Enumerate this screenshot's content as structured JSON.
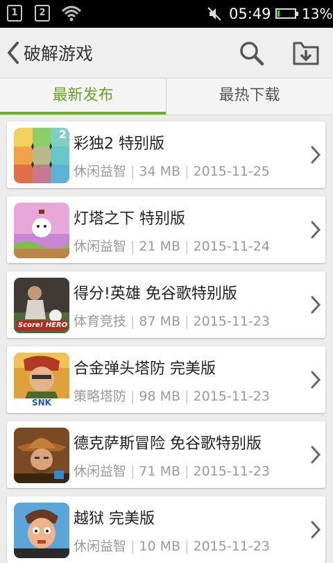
{
  "status_bar": {
    "sim1": "1",
    "sim2": "2",
    "time": "05:49",
    "battery_percent": "13%",
    "battery_level": 0.13
  },
  "header": {
    "title": "破解游戏"
  },
  "tabs": [
    {
      "label": "最新发布",
      "active": true
    },
    {
      "label": "最热下载",
      "active": false
    }
  ],
  "apps": [
    {
      "name": "彩独2 特别版",
      "category": "休闲益智",
      "size": "34 MB",
      "date": "2015-11-25",
      "icon": "color-sudoku-icon"
    },
    {
      "name": "灯塔之下 特别版",
      "category": "休闲益智",
      "size": "21 MB",
      "date": "2015-11-24",
      "icon": "lighthouse-icon"
    },
    {
      "name": "得分!英雄 免谷歌特别版",
      "category": "体育竞技",
      "size": "87 MB",
      "date": "2015-11-23",
      "icon": "score-hero-icon"
    },
    {
      "name": "合金弹头塔防 完美版",
      "category": "策略塔防",
      "size": "98 MB",
      "date": "2015-11-23",
      "icon": "metal-slug-defense-icon"
    },
    {
      "name": "德克萨斯冒险 免谷歌特别版",
      "category": "休闲益智",
      "size": "71 MB",
      "date": "2015-11-23",
      "icon": "texas-cowboy-icon"
    },
    {
      "name": "越狱 完美版",
      "category": "休闲益智",
      "size": "10 MB",
      "date": "2015-11-23",
      "icon": "prison-break-icon"
    }
  ],
  "icon_logos": {
    "score_hero": "Score! HERO",
    "snk": "SNK",
    "sudoku_badge": "2"
  },
  "colors": {
    "accent_green": "#6ab21f",
    "status_bar": "#000000",
    "battery_green": "#4cd02a"
  }
}
